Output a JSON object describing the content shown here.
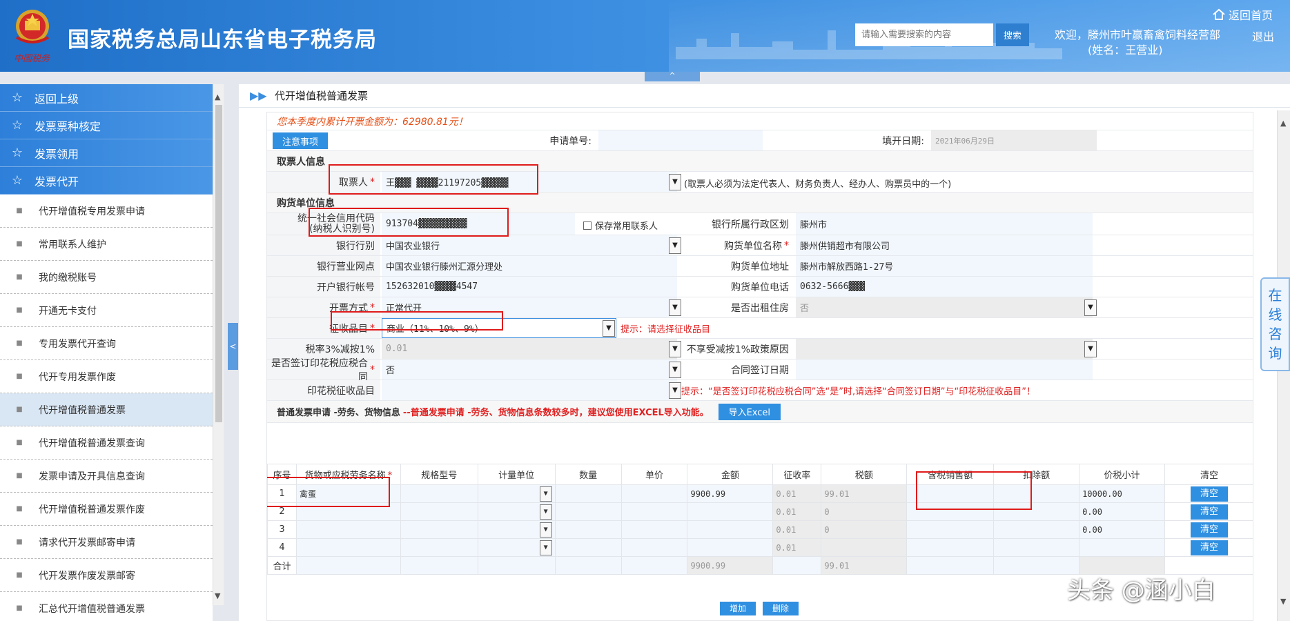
{
  "header": {
    "emblem_caption": "中国税务",
    "site_title": "国家税务总局山东省电子税务局",
    "search_placeholder": "请输入需要搜索的内容",
    "search_button": "搜索",
    "home_link": "返回首页",
    "welcome_line1": "欢迎，滕州市叶赢畜禽饲料经营部",
    "welcome_line2": "(姓名：王营业)",
    "logout": "退出",
    "collapse_glyph": "^"
  },
  "sidebar": {
    "main_items": [
      {
        "label": "返回上级"
      },
      {
        "label": "发票票种核定"
      },
      {
        "label": "发票领用"
      },
      {
        "label": "发票代开"
      }
    ],
    "sub_items": [
      {
        "label": "代开增值税专用发票申请"
      },
      {
        "label": "常用联系人维护"
      },
      {
        "label": "我的缴税账号"
      },
      {
        "label": "开通无卡支付"
      },
      {
        "label": "专用发票代开查询"
      },
      {
        "label": "代开专用发票作废"
      },
      {
        "label": "代开增值税普通发票"
      },
      {
        "label": "代开增值税普通发票查询"
      },
      {
        "label": "发票申请及开具信息查询"
      },
      {
        "label": "代开增值税普通发票作废"
      },
      {
        "label": "请求代开发票邮寄申请"
      },
      {
        "label": "代开发票作废发票邮寄"
      },
      {
        "label": "汇总代开增值税普通发票"
      }
    ],
    "active_item": "代开增值税普通发票",
    "toggle_glyph": "<"
  },
  "main": {
    "tab_title": "代开增值税普通发票",
    "quarter_notice": "您本季度内累计开票金额为：62980.81元！",
    "notice_button": "注意事项",
    "application_no_label": "申请单号:",
    "application_no_value": "",
    "fill_date_label": "填开日期:",
    "fill_date_value": "2021年06月29日",
    "collector_section": "取票人信息",
    "collector_label": "取票人",
    "collector_value": "王▓▓▓ ▓▓▓▓21197205▓▓▓▓▓",
    "collector_hint": "(取票人必须为法定代表人、财务负责人、经办人、购票员中的一个)",
    "buyer_section": "购货单位信息",
    "credit_code_label_1": "统一社会信用代码",
    "credit_code_label_2": "(纳税人识别号)",
    "credit_code_value": "913704▓▓▓▓▓▓▓▓▓",
    "save_contact_label": "保存常用联系人",
    "bank_region_label": "银行所属行政区划",
    "bank_region_value": "滕州市",
    "bank_type_label": "银行行别",
    "bank_type_value": "中国农业银行",
    "buyer_name_label": "购货单位名称",
    "buyer_name_value": "滕州供销超市有限公司",
    "bank_branch_label": "银行营业网点",
    "bank_branch_value": "中国农业银行滕州汇源分理处",
    "buyer_address_label": "购货单位地址",
    "buyer_address_value": "滕州市解放西路1-27号",
    "bank_account_label": "开户银行帐号",
    "bank_account_value": "152632010▓▓▓▓4547",
    "buyer_phone_label": "购货单位电话",
    "buyer_phone_value": "0632-5666▓▓▓",
    "issue_mode_label": "开票方式",
    "issue_mode_value": "正常代开",
    "rental_label": "是否出租住房",
    "rental_value": "否",
    "tax_item_label": "征收品目",
    "tax_item_value": "商业（11%、10%、9%）",
    "tax_item_hint": "提示：请选择征收品目",
    "rate_reduce_label": "税率3%减按1%",
    "rate_reduce_value": "0.01",
    "no_reduce_reason_label": "不享受减按1%政策原因",
    "stamp_contract_label": "是否签订印花税应税合同",
    "stamp_contract_value": "否",
    "contract_date_label": "合同签订日期",
    "stamp_item_label": "印花税征收品目",
    "stamp_hint": "提示：“是否签订印花税应税合同”选“是”时,请选择“合同签订日期”与“印花税征收品目”！",
    "goods_section": "普通发票申请 -劳务、货物信息",
    "goods_section_hint": "--普通发票申请 -劳务、货物信息条数较多时，建议您使用EXCEL导入功能。",
    "import_button": "导入Excel",
    "table_headers": [
      "序号",
      "货物或应税劳务名称",
      "规格型号",
      "计量单位",
      "数量",
      "单价",
      "金额",
      "征收率",
      "税额",
      "含税销售额",
      "扣除额",
      "价税小计",
      "清空"
    ],
    "rows": [
      {
        "idx": "1",
        "name": "禽蛋",
        "amount": "9900.99",
        "rate": "0.01",
        "tax": "99.01",
        "subtotal": "10000.00",
        "clear": "清空"
      },
      {
        "idx": "2",
        "name": "",
        "amount": "",
        "rate": "0.01",
        "tax": "0",
        "subtotal": "0.00",
        "clear": "清空"
      },
      {
        "idx": "3",
        "name": "",
        "amount": "",
        "rate": "0.01",
        "tax": "0",
        "subtotal": "0.00",
        "clear": "清空"
      },
      {
        "idx": "4",
        "name": "",
        "amount": "",
        "rate": "0.01",
        "tax": "",
        "subtotal": "",
        "clear": "清空"
      }
    ],
    "total_label": "合计",
    "total_amount": "9900.99",
    "total_tax": "99.01",
    "add_button": "增加",
    "delete_button": "删除"
  },
  "consult_tab": "在线咨询",
  "watermark": "头条 @涵小白",
  "colors": {
    "header_blue": "#2d7fd9",
    "accent": "#2f8fe0",
    "alert": "#e02020",
    "notice": "#e64d13"
  }
}
